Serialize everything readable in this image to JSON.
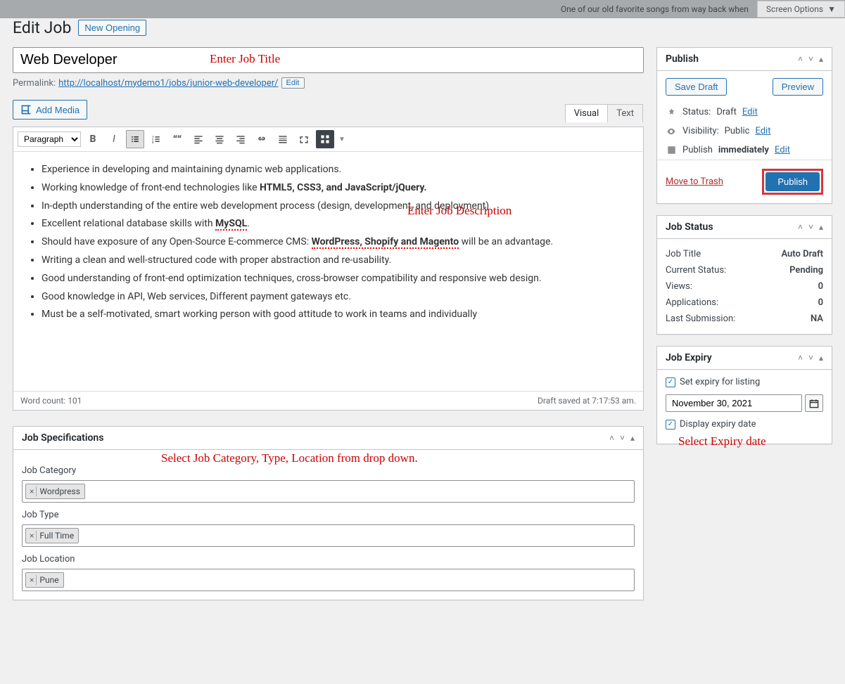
{
  "topbar": {
    "message": "One of our old favorite songs from way back when",
    "screen_options": "Screen Options"
  },
  "header": {
    "title": "Edit Job",
    "new_btn": "New Opening"
  },
  "title_field": {
    "value": "Web Developer",
    "annotation": "Enter Job Title"
  },
  "permalink": {
    "label": "Permalink:",
    "url": "http://localhost/mydemo1/jobs/junior-web-developer/",
    "edit": "Edit"
  },
  "media_btn": "Add Media",
  "editor_tabs": {
    "visual": "Visual",
    "text": "Text"
  },
  "toolbar": {
    "format": "Paragraph"
  },
  "description": {
    "annotation": "Enter Job Description",
    "items": [
      {
        "pre": "Experience in developing and maintaining dynamic web applications."
      },
      {
        "pre": "Working knowledge of front-end technologies like ",
        "bold": "HTML5, CSS3, and JavaScript/jQuery."
      },
      {
        "pre": "In-depth understanding of the entire web development process (design, development, and deployment)"
      },
      {
        "pre": "Excellent relational database skills with ",
        "bold_wave": "MySQL",
        "post": "."
      },
      {
        "pre": "Should have exposure of any Open-Source E-commerce CMS: ",
        "bold_wave": "WordPress, Shopify and Magento",
        "post": " will be an advantage."
      },
      {
        "pre": "Writing a clean and well-structured code with proper abstraction and re-usability."
      },
      {
        "pre": "Good understanding of front-end optimization techniques, cross-browser compatibility and responsive web design."
      },
      {
        "pre": "Good knowledge in API, Web services, Different payment gateways etc."
      },
      {
        "pre": "Must be a self-motivated, smart working person with good attitude to work in teams and individually"
      }
    ]
  },
  "editor_footer": {
    "wordcount_label": "Word count: ",
    "wordcount": "101",
    "saved": "Draft saved at 7:17:53 am."
  },
  "publish": {
    "title": "Publish",
    "save_draft": "Save Draft",
    "preview": "Preview",
    "status_label": "Status:",
    "status_value": "Draft",
    "status_edit": "Edit",
    "visibility_label": "Visibility:",
    "visibility_value": "Public",
    "visibility_edit": "Edit",
    "publish_label": "Publish",
    "publish_value": "immediately",
    "publish_edit": "Edit",
    "trash": "Move to Trash",
    "publish_btn": "Publish"
  },
  "job_status": {
    "title": "Job Status",
    "rows": [
      {
        "label": "Job Title",
        "value": "Auto Draft"
      },
      {
        "label": "Current Status:",
        "value": "Pending"
      },
      {
        "label": "Views:",
        "value": "0"
      },
      {
        "label": "Applications:",
        "value": "0"
      },
      {
        "label": "Last Submission:",
        "value": "NA"
      }
    ]
  },
  "job_expiry": {
    "title": "Job Expiry",
    "set_label": "Set expiry for listing",
    "date": "November 30, 2021",
    "display_label": "Display expiry date",
    "annotation": "Select Expiry date"
  },
  "specs": {
    "title": "Job Specifications",
    "annotation": "Select Job Category, Type, Location from drop down.",
    "category_label": "Job Category",
    "category_value": "Wordpress",
    "type_label": "Job Type",
    "type_value": "Full Time",
    "location_label": "Job Location",
    "location_value": "Pune"
  }
}
